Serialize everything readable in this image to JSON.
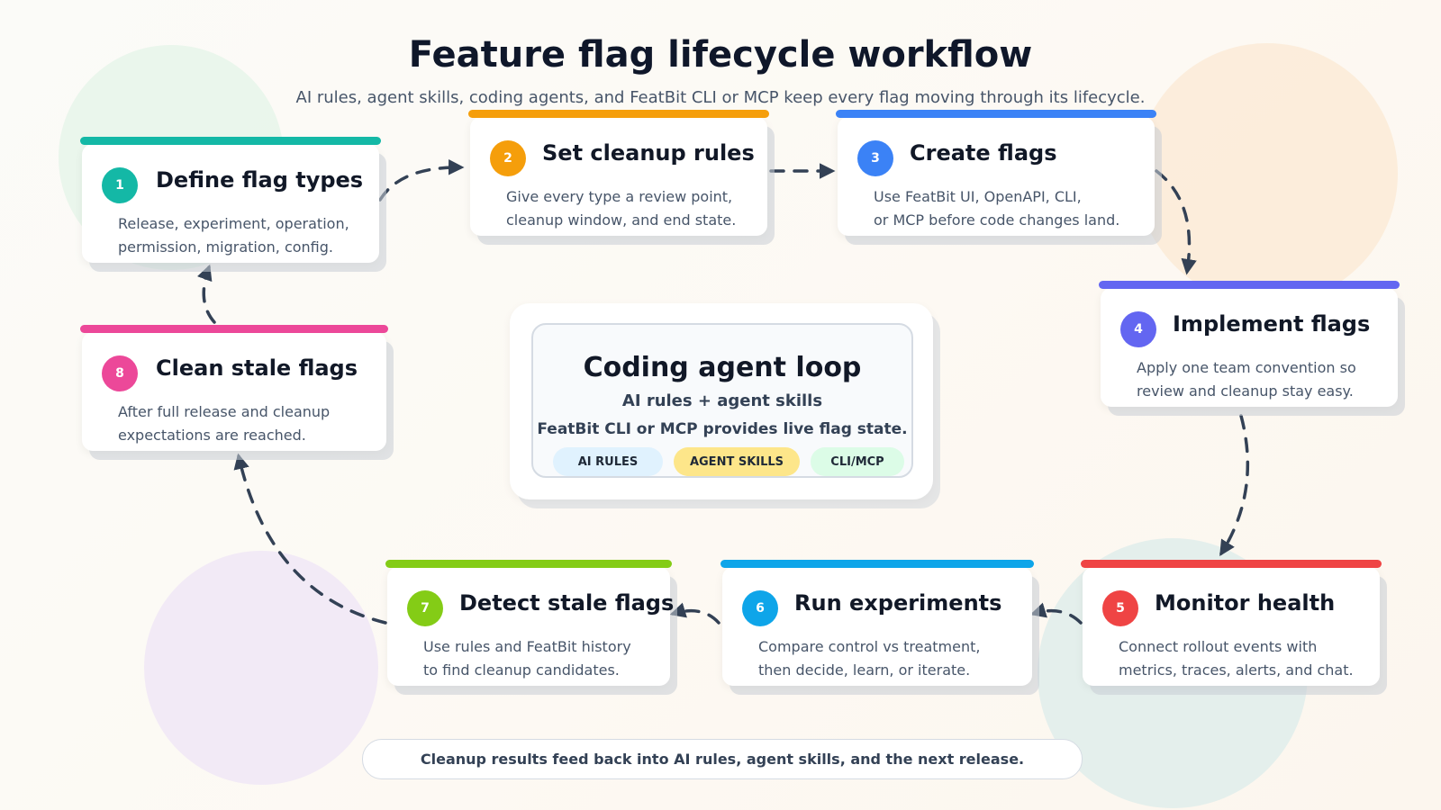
{
  "title": "Feature flag lifecycle workflow",
  "subtitle": "AI rules, agent skills, coding agents, and FeatBit CLI or MCP keep every flag moving through its lifecycle.",
  "steps": [
    {
      "number": "1",
      "title": "Define flag types",
      "desc1": "Release, experiment, operation,",
      "desc2": "permission, migration, config.",
      "color": "#14b8a6"
    },
    {
      "number": "2",
      "title": "Set cleanup rules",
      "desc1": "Give every type a review point,",
      "desc2": "cleanup window, and end state.",
      "color": "#f59e0b"
    },
    {
      "number": "3",
      "title": "Create flags",
      "desc1": "Use FeatBit UI, OpenAPI, CLI,",
      "desc2": "or MCP before code changes land.",
      "color": "#3b82f6"
    },
    {
      "number": "4",
      "title": "Implement flags",
      "desc1": "Apply one team convention so",
      "desc2": "review and cleanup stay easy.",
      "color": "#6366f1"
    },
    {
      "number": "5",
      "title": "Monitor health",
      "desc1": "Connect rollout events with",
      "desc2": "metrics, traces, alerts, and chat.",
      "color": "#ef4444"
    },
    {
      "number": "6",
      "title": "Run experiments",
      "desc1": "Compare control vs treatment,",
      "desc2": "then decide, learn, or iterate.",
      "color": "#0ea5e9"
    },
    {
      "number": "7",
      "title": "Detect stale flags",
      "desc1": "Use rules and FeatBit history",
      "desc2": "to find cleanup candidates.",
      "color": "#84cc16"
    },
    {
      "number": "8",
      "title": "Clean stale flags",
      "desc1": "After full release and cleanup",
      "desc2": "expectations are reached.",
      "color": "#ec4899"
    }
  ],
  "center": {
    "title": "Coding agent loop",
    "line1": "AI rules + agent skills",
    "line2": "FeatBit CLI or MCP provides live flag state.",
    "pills": [
      {
        "label": "AI RULES",
        "color": "#e0f2fe"
      },
      {
        "label": "AGENT SKILLS",
        "color": "#fde68a"
      },
      {
        "label": "CLI/MCP",
        "color": "#dcfce7"
      }
    ]
  },
  "footer": "Cleanup results feed back into AI rules, agent skills, and the next release.",
  "colors": {
    "arrow": "#334155",
    "blob_green": "#e6f4ea",
    "blob_orange": "#fdebd6",
    "blob_purple": "#f1e9f7",
    "blob_teal": "#e3efec"
  }
}
